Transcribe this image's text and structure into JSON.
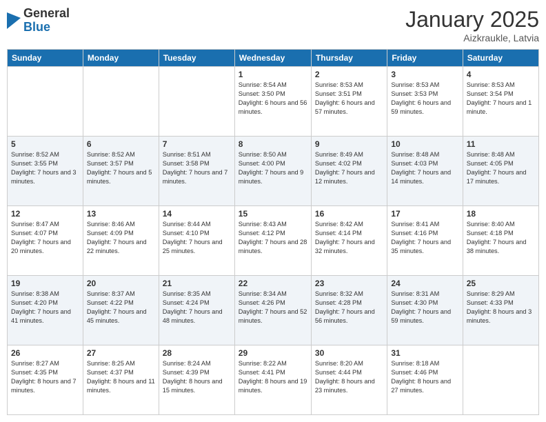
{
  "header": {
    "logo_general": "General",
    "logo_blue": "Blue",
    "month_title": "January 2025",
    "location": "Aizkraukle, Latvia"
  },
  "days_of_week": [
    "Sunday",
    "Monday",
    "Tuesday",
    "Wednesday",
    "Thursday",
    "Friday",
    "Saturday"
  ],
  "weeks": [
    [
      {
        "day": "",
        "sunrise": "",
        "sunset": "",
        "daylight": ""
      },
      {
        "day": "",
        "sunrise": "",
        "sunset": "",
        "daylight": ""
      },
      {
        "day": "",
        "sunrise": "",
        "sunset": "",
        "daylight": ""
      },
      {
        "day": "1",
        "sunrise": "Sunrise: 8:54 AM",
        "sunset": "Sunset: 3:50 PM",
        "daylight": "Daylight: 6 hours and 56 minutes."
      },
      {
        "day": "2",
        "sunrise": "Sunrise: 8:53 AM",
        "sunset": "Sunset: 3:51 PM",
        "daylight": "Daylight: 6 hours and 57 minutes."
      },
      {
        "day": "3",
        "sunrise": "Sunrise: 8:53 AM",
        "sunset": "Sunset: 3:53 PM",
        "daylight": "Daylight: 6 hours and 59 minutes."
      },
      {
        "day": "4",
        "sunrise": "Sunrise: 8:53 AM",
        "sunset": "Sunset: 3:54 PM",
        "daylight": "Daylight: 7 hours and 1 minute."
      }
    ],
    [
      {
        "day": "5",
        "sunrise": "Sunrise: 8:52 AM",
        "sunset": "Sunset: 3:55 PM",
        "daylight": "Daylight: 7 hours and 3 minutes."
      },
      {
        "day": "6",
        "sunrise": "Sunrise: 8:52 AM",
        "sunset": "Sunset: 3:57 PM",
        "daylight": "Daylight: 7 hours and 5 minutes."
      },
      {
        "day": "7",
        "sunrise": "Sunrise: 8:51 AM",
        "sunset": "Sunset: 3:58 PM",
        "daylight": "Daylight: 7 hours and 7 minutes."
      },
      {
        "day": "8",
        "sunrise": "Sunrise: 8:50 AM",
        "sunset": "Sunset: 4:00 PM",
        "daylight": "Daylight: 7 hours and 9 minutes."
      },
      {
        "day": "9",
        "sunrise": "Sunrise: 8:49 AM",
        "sunset": "Sunset: 4:02 PM",
        "daylight": "Daylight: 7 hours and 12 minutes."
      },
      {
        "day": "10",
        "sunrise": "Sunrise: 8:48 AM",
        "sunset": "Sunset: 4:03 PM",
        "daylight": "Daylight: 7 hours and 14 minutes."
      },
      {
        "day": "11",
        "sunrise": "Sunrise: 8:48 AM",
        "sunset": "Sunset: 4:05 PM",
        "daylight": "Daylight: 7 hours and 17 minutes."
      }
    ],
    [
      {
        "day": "12",
        "sunrise": "Sunrise: 8:47 AM",
        "sunset": "Sunset: 4:07 PM",
        "daylight": "Daylight: 7 hours and 20 minutes."
      },
      {
        "day": "13",
        "sunrise": "Sunrise: 8:46 AM",
        "sunset": "Sunset: 4:09 PM",
        "daylight": "Daylight: 7 hours and 22 minutes."
      },
      {
        "day": "14",
        "sunrise": "Sunrise: 8:44 AM",
        "sunset": "Sunset: 4:10 PM",
        "daylight": "Daylight: 7 hours and 25 minutes."
      },
      {
        "day": "15",
        "sunrise": "Sunrise: 8:43 AM",
        "sunset": "Sunset: 4:12 PM",
        "daylight": "Daylight: 7 hours and 28 minutes."
      },
      {
        "day": "16",
        "sunrise": "Sunrise: 8:42 AM",
        "sunset": "Sunset: 4:14 PM",
        "daylight": "Daylight: 7 hours and 32 minutes."
      },
      {
        "day": "17",
        "sunrise": "Sunrise: 8:41 AM",
        "sunset": "Sunset: 4:16 PM",
        "daylight": "Daylight: 7 hours and 35 minutes."
      },
      {
        "day": "18",
        "sunrise": "Sunrise: 8:40 AM",
        "sunset": "Sunset: 4:18 PM",
        "daylight": "Daylight: 7 hours and 38 minutes."
      }
    ],
    [
      {
        "day": "19",
        "sunrise": "Sunrise: 8:38 AM",
        "sunset": "Sunset: 4:20 PM",
        "daylight": "Daylight: 7 hours and 41 minutes."
      },
      {
        "day": "20",
        "sunrise": "Sunrise: 8:37 AM",
        "sunset": "Sunset: 4:22 PM",
        "daylight": "Daylight: 7 hours and 45 minutes."
      },
      {
        "day": "21",
        "sunrise": "Sunrise: 8:35 AM",
        "sunset": "Sunset: 4:24 PM",
        "daylight": "Daylight: 7 hours and 48 minutes."
      },
      {
        "day": "22",
        "sunrise": "Sunrise: 8:34 AM",
        "sunset": "Sunset: 4:26 PM",
        "daylight": "Daylight: 7 hours and 52 minutes."
      },
      {
        "day": "23",
        "sunrise": "Sunrise: 8:32 AM",
        "sunset": "Sunset: 4:28 PM",
        "daylight": "Daylight: 7 hours and 56 minutes."
      },
      {
        "day": "24",
        "sunrise": "Sunrise: 8:31 AM",
        "sunset": "Sunset: 4:30 PM",
        "daylight": "Daylight: 7 hours and 59 minutes."
      },
      {
        "day": "25",
        "sunrise": "Sunrise: 8:29 AM",
        "sunset": "Sunset: 4:33 PM",
        "daylight": "Daylight: 8 hours and 3 minutes."
      }
    ],
    [
      {
        "day": "26",
        "sunrise": "Sunrise: 8:27 AM",
        "sunset": "Sunset: 4:35 PM",
        "daylight": "Daylight: 8 hours and 7 minutes."
      },
      {
        "day": "27",
        "sunrise": "Sunrise: 8:25 AM",
        "sunset": "Sunset: 4:37 PM",
        "daylight": "Daylight: 8 hours and 11 minutes."
      },
      {
        "day": "28",
        "sunrise": "Sunrise: 8:24 AM",
        "sunset": "Sunset: 4:39 PM",
        "daylight": "Daylight: 8 hours and 15 minutes."
      },
      {
        "day": "29",
        "sunrise": "Sunrise: 8:22 AM",
        "sunset": "Sunset: 4:41 PM",
        "daylight": "Daylight: 8 hours and 19 minutes."
      },
      {
        "day": "30",
        "sunrise": "Sunrise: 8:20 AM",
        "sunset": "Sunset: 4:44 PM",
        "daylight": "Daylight: 8 hours and 23 minutes."
      },
      {
        "day": "31",
        "sunrise": "Sunrise: 8:18 AM",
        "sunset": "Sunset: 4:46 PM",
        "daylight": "Daylight: 8 hours and 27 minutes."
      },
      {
        "day": "",
        "sunrise": "",
        "sunset": "",
        "daylight": ""
      }
    ]
  ]
}
